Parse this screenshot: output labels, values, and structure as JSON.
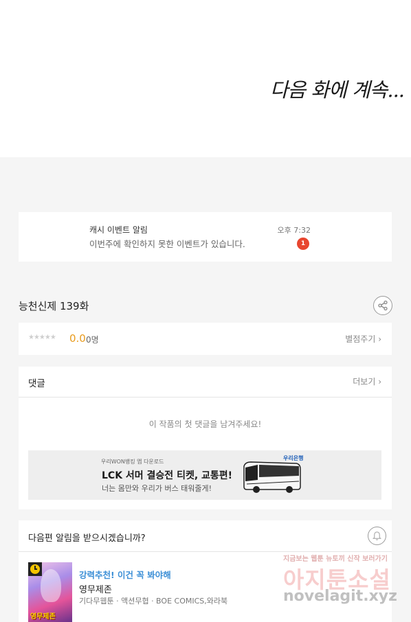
{
  "comic": {
    "caption": "다음 화에 계속..."
  },
  "event_notification": {
    "title": "캐시 이벤트 알림",
    "message": "이번주에 확인하지 못한 이벤트가 있습니다.",
    "time": "오후 7:32",
    "badge_count": "1"
  },
  "episode": {
    "title": "능천신제 139화",
    "share_icon": "share-icon"
  },
  "rating": {
    "stars_display": "★★★★★",
    "score": "0.0",
    "count": "0명",
    "rate_link": "별점주기 ›"
  },
  "comments": {
    "title": "댓글",
    "more_link": "더보기 ›",
    "empty_message": "이 작품의 첫 댓글을 남겨주세요!"
  },
  "ad": {
    "top_line": "우리WON뱅킹 앱 다운로드",
    "headline": "LCK 서머 결승전 티켓, 교통편!",
    "sub_line": "너는 몸만와 우리가 버스 태워줄게!",
    "logo_text": "우리은행"
  },
  "next_episode_alert": {
    "question": "다음편 알림을 받으시겠습니까?",
    "bell_icon": "bell-icon"
  },
  "recommendation": {
    "tag": "강력추천! 이건 꼭 봐야해",
    "title": "영무제존",
    "meta": "기다무웹툰 · 액션무협 · BOE COMICS,와라북",
    "thumb_title": "영무제존"
  },
  "watermark": {
    "top": "지금보는 웹툰 뉴토끼 신작 보러가기",
    "main": "아지툰소설",
    "url": "novelagit.xyz"
  }
}
